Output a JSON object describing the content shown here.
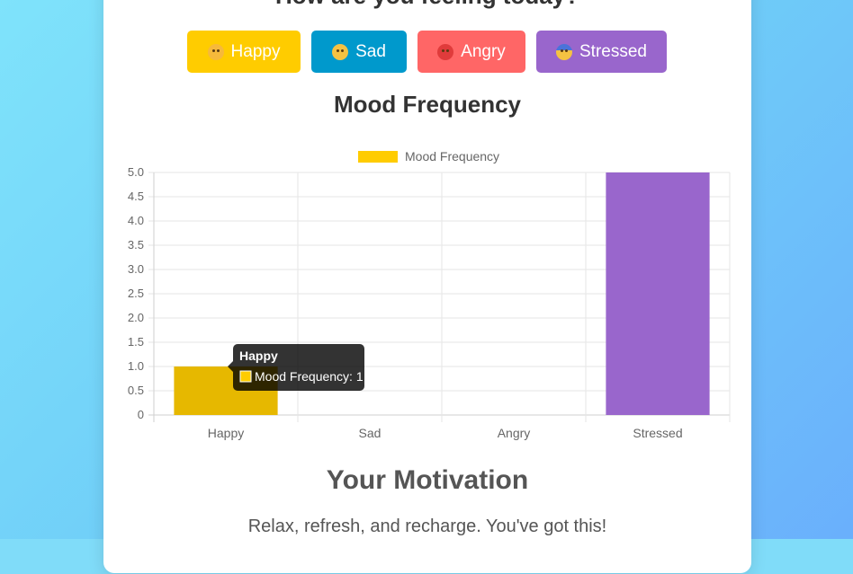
{
  "question": "How are you feeling today?",
  "mood_buttons": [
    {
      "label": "Happy",
      "icon": "smiling-face-icon",
      "color": "#ffcc00"
    },
    {
      "label": "Sad",
      "icon": "flushed-face-icon",
      "color": "#0099cc"
    },
    {
      "label": "Angry",
      "icon": "angry-face-icon",
      "color": "#ff6666"
    },
    {
      "label": "Stressed",
      "icon": "fearful-face-icon",
      "color": "#9966cc"
    }
  ],
  "chart_title": "Mood Frequency",
  "chart_data": {
    "type": "bar",
    "categories": [
      "Happy",
      "Sad",
      "Angry",
      "Stressed"
    ],
    "series": [
      {
        "name": "Mood Frequency",
        "values": [
          1,
          0,
          0,
          5
        ]
      }
    ],
    "bar_colors": [
      "#e6b800",
      "#0099cc",
      "#ff6666",
      "#9966cc"
    ],
    "legend_color": "#ffcc00",
    "ylim": [
      0,
      5
    ],
    "yticks": [
      "0",
      "0.5",
      "1.0",
      "1.5",
      "2.0",
      "2.5",
      "3.0",
      "3.5",
      "4.0",
      "4.5",
      "5.0"
    ],
    "grid": true,
    "legend_position": "top"
  },
  "tooltip": {
    "title": "Happy",
    "label": "Mood Frequency: 1",
    "swatch_color": "#ffcc00"
  },
  "motivation_title": "Your Motivation",
  "motivation_text": "Relax, refresh, and recharge. You've got this!"
}
